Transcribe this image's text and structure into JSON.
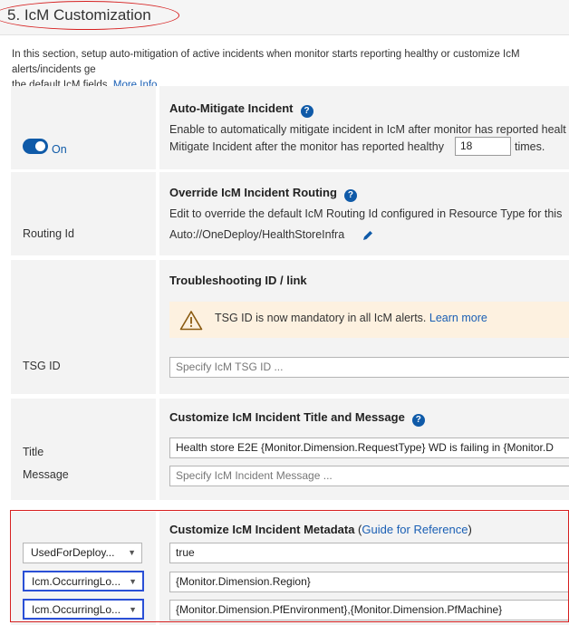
{
  "section": {
    "title": "5. IcM Customization",
    "intro_line1": "In this section, setup auto-mitigation of active incidents when monitor starts reporting healthy or customize IcM alerts/incidents ge",
    "intro_line2": "the default IcM fields.",
    "more_info": "More Info."
  },
  "auto_mitigate": {
    "title": "Auto-Mitigate Incident",
    "desc_line1": "Enable to automatically mitigate incident in IcM after monitor has reported healt",
    "desc_prefix": "Mitigate Incident after the monitor has reported healthy",
    "times_value": "18",
    "desc_suffix": "times.",
    "toggle_label": "On",
    "toggle_state": "on"
  },
  "routing": {
    "label": "Routing Id",
    "title": "Override IcM Incident Routing",
    "desc": "Edit to override the default IcM Routing Id configured in Resource Type for this",
    "value": "Auto://OneDeploy/HealthStoreInfra"
  },
  "tsg": {
    "title": "Troubleshooting ID / link",
    "warning": "TSG ID is now mandatory in all IcM alerts.",
    "learn_more": "Learn more",
    "label": "TSG ID",
    "placeholder": "Specify IcM TSG ID ..."
  },
  "title_message": {
    "heading": "Customize IcM Incident Title and Message",
    "title_label": "Title",
    "title_value": "Health store E2E {Monitor.Dimension.RequestType}  WD is failing in {Monitor.D",
    "message_label": "Message",
    "message_placeholder": "Specify IcM Incident Message ..."
  },
  "metadata": {
    "heading": "Customize IcM Incident Metadata",
    "guide_open": "(",
    "guide_link": "Guide for Reference",
    "guide_close": ")",
    "rows": [
      {
        "key": "UsedForDeploy...",
        "value": "true"
      },
      {
        "key": "Icm.OccurringLo...",
        "value": "{Monitor.Dimension.Region}"
      },
      {
        "key": "Icm.OccurringLo...",
        "value": "{Monitor.Dimension.PfEnvironment},{Monitor.Dimension.PfMachine}"
      }
    ]
  },
  "colors": {
    "accent": "#0f5aa8",
    "annotation_red": "#d62020",
    "annotation_blue": "#2a4fd6",
    "warning_bg": "#fdf1e0"
  }
}
